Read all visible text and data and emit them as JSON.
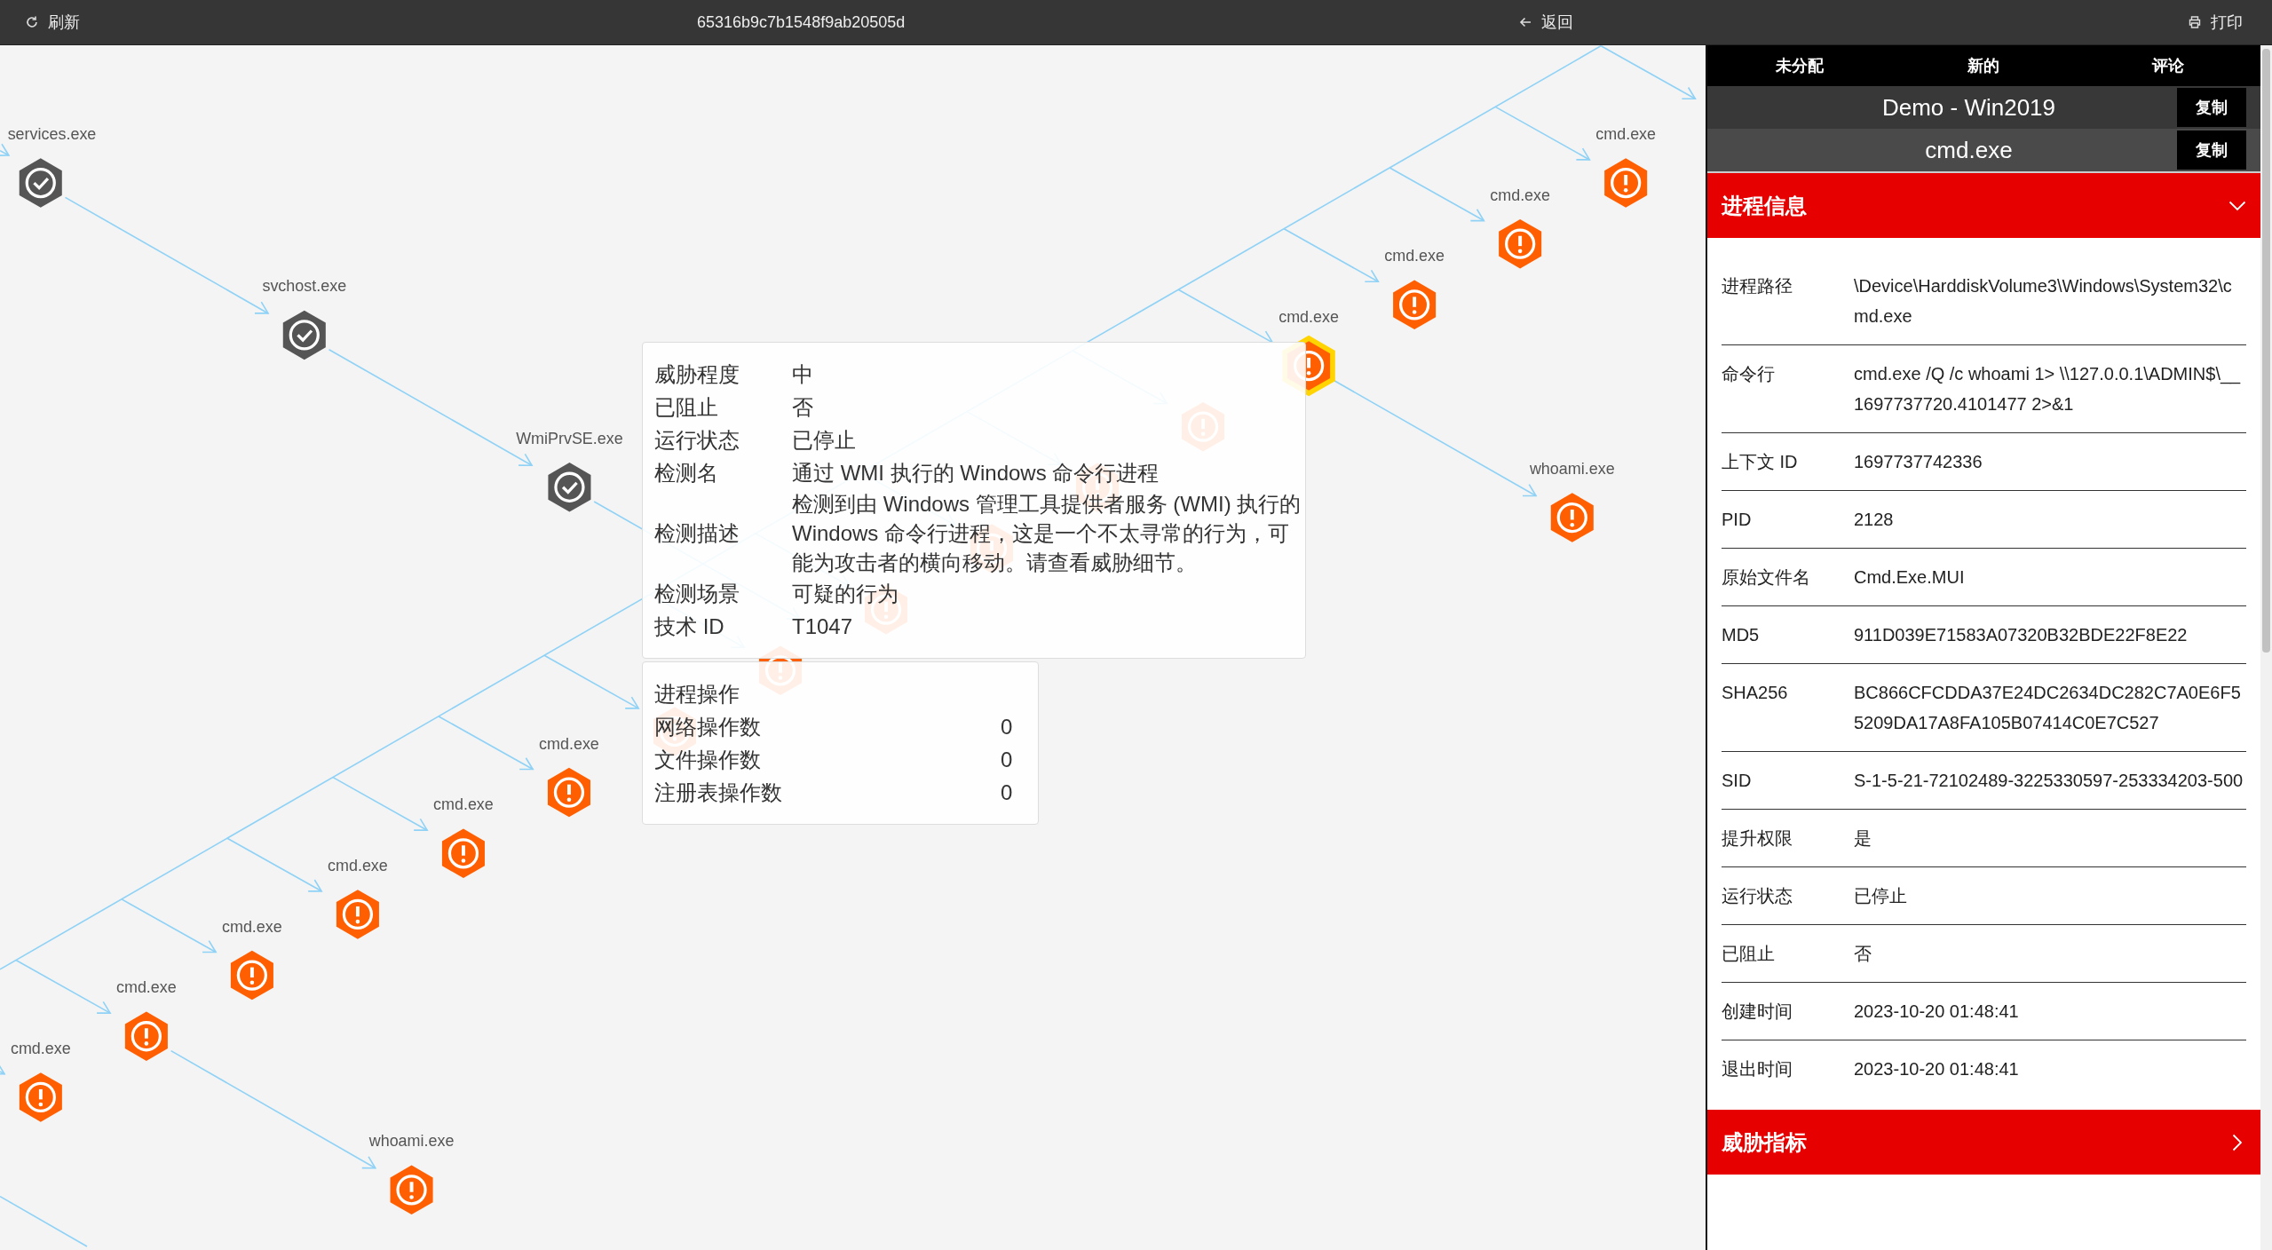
{
  "topbar": {
    "refresh": "刷新",
    "title": "65316b9c7b1548f9ab20505d",
    "back": "返回",
    "print": "打印"
  },
  "graph": {
    "nodes": [
      {
        "label": "services.exe",
        "kind": "ok",
        "selected": false
      },
      {
        "label": "svchost.exe",
        "kind": "ok",
        "selected": false
      },
      {
        "label": "WmiPrvSE.exe",
        "kind": "ok",
        "selected": false
      },
      {
        "label": "cmd.exe",
        "kind": "alert",
        "selected": false
      },
      {
        "label": "cmd.exe",
        "kind": "alert",
        "selected": false
      },
      {
        "label": "cmd.exe",
        "kind": "alert",
        "selected": false
      },
      {
        "label": "cmd.exe",
        "kind": "alert",
        "selected": true
      },
      {
        "kind": "alert",
        "selected": false
      },
      {
        "kind": "alert",
        "selected": false
      },
      {
        "kind": "alert",
        "selected": false
      },
      {
        "kind": "alert",
        "selected": false
      },
      {
        "kind": "alert",
        "selected": false
      },
      {
        "kind": "alert",
        "selected": false
      },
      {
        "label": "cmd.exe",
        "kind": "alert",
        "selected": false
      },
      {
        "label": "cmd.exe",
        "kind": "alert",
        "selected": false
      },
      {
        "label": "cmd.exe",
        "kind": "alert",
        "selected": false
      },
      {
        "label": "cmd.exe",
        "kind": "alert",
        "selected": false
      },
      {
        "label": "cmd.exe",
        "kind": "alert",
        "selected": false
      },
      {
        "label": "cmd.exe",
        "kind": "alert",
        "selected": false
      },
      {
        "label": "whoami.exe",
        "kind": "alert",
        "selected": false
      },
      {
        "label": "whoami.exe",
        "kind": "alert",
        "selected": false
      }
    ]
  },
  "tooltip": {
    "details": [
      {
        "label": "威胁程度",
        "value": "中"
      },
      {
        "label": "已阻止",
        "value": "否"
      },
      {
        "label": "运行状态",
        "value": "已停止"
      },
      {
        "label": "检测名",
        "value": "通过 WMI 执行的 Windows 命令行进程"
      },
      {
        "label": "检测描述",
        "value": "检测到由 Windows 管理工具提供者服务 (WMI) 执行的 Windows 命令行进程，这是一个不太寻常的行为，可能为攻击者的横向移动。请查看威胁细节。"
      },
      {
        "label": "检测场景",
        "value": "可疑的行为"
      },
      {
        "label": "技术 ID",
        "value": "T1047"
      }
    ],
    "operations": {
      "title": "进程操作",
      "rows": [
        {
          "label": "网络操作数",
          "value": "0"
        },
        {
          "label": "文件操作数",
          "value": "0"
        },
        {
          "label": "注册表操作数",
          "value": "0"
        }
      ]
    }
  },
  "panel": {
    "actions": [
      "未分配",
      "新的",
      "评论"
    ],
    "host": {
      "text": "Demo - Win2019",
      "copy": "复制"
    },
    "process": {
      "text": "cmd.exe",
      "copy": "复制"
    },
    "sections": [
      {
        "title": "进程信息",
        "expanded": true,
        "rows": [
          {
            "label": "进程路径",
            "value": "\\Device\\HarddiskVolume3\\Windows\\System32\\cmd.exe"
          },
          {
            "label": "命令行",
            "value": "cmd.exe /Q /c whoami 1> \\\\127.0.0.1\\ADMIN$\\__1697737720.4101477 2>&1"
          },
          {
            "label": "上下文 ID",
            "value": "1697737742336"
          },
          {
            "label": "PID",
            "value": "2128"
          },
          {
            "label": "原始文件名",
            "value": "Cmd.Exe.MUI"
          },
          {
            "label": "MD5",
            "value": "911D039E71583A07320B32BDE22F8E22"
          },
          {
            "label": "SHA256",
            "value": "BC866CFCDDA37E24DC2634DC282C7A0E6F55209DA17A8FA105B07414C0E7C527"
          },
          {
            "label": "SID",
            "value": "S-1-5-21-72102489-3225330597-253334203-500"
          },
          {
            "label": "提升权限",
            "value": "是"
          },
          {
            "label": "运行状态",
            "value": "已停止"
          },
          {
            "label": "已阻止",
            "value": "否"
          },
          {
            "label": "创建时间",
            "value": "2023-10-20 01:48:41"
          },
          {
            "label": "退出时间",
            "value": "2023-10-20 01:48:41"
          }
        ]
      },
      {
        "title": "威胁指标",
        "expanded": false
      }
    ]
  }
}
